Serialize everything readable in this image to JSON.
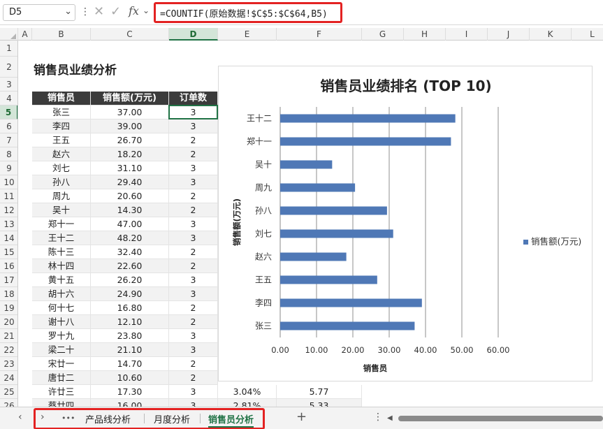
{
  "formula_bar": {
    "name_box": "D5",
    "fx_label": "fx",
    "formula": "=COUNTIF(原始数据!$C$5:$C$64,B5)"
  },
  "columns": [
    "A",
    "B",
    "C",
    "D",
    "E",
    "F",
    "G",
    "H",
    "I",
    "J",
    "K",
    "L"
  ],
  "rows": [
    "1",
    "2",
    "3",
    "4",
    "5",
    "6",
    "7",
    "8",
    "9",
    "10",
    "11",
    "12",
    "13",
    "14",
    "15",
    "16",
    "17",
    "18",
    "19",
    "20",
    "21",
    "22",
    "23",
    "24",
    "25",
    "26"
  ],
  "sheet_title": "销售员业绩分析",
  "table": {
    "headers": [
      "销售员",
      "销售额(万元)",
      "订单数"
    ],
    "rows": [
      [
        "张三",
        "37.00",
        "3"
      ],
      [
        "李四",
        "39.00",
        "3"
      ],
      [
        "王五",
        "26.70",
        "2"
      ],
      [
        "赵六",
        "18.20",
        "2"
      ],
      [
        "刘七",
        "31.10",
        "3"
      ],
      [
        "孙八",
        "29.40",
        "3"
      ],
      [
        "周九",
        "20.60",
        "2"
      ],
      [
        "吴十",
        "14.30",
        "2"
      ],
      [
        "郑十一",
        "47.00",
        "3"
      ],
      [
        "王十二",
        "48.20",
        "3"
      ],
      [
        "陈十三",
        "32.40",
        "2"
      ],
      [
        "林十四",
        "22.60",
        "2"
      ],
      [
        "黄十五",
        "26.20",
        "3"
      ],
      [
        "胡十六",
        "24.90",
        "3"
      ],
      [
        "何十七",
        "16.80",
        "2"
      ],
      [
        "谢十八",
        "12.10",
        "2"
      ],
      [
        "罗十九",
        "23.80",
        "3"
      ],
      [
        "梁二十",
        "21.10",
        "3"
      ],
      [
        "宋廿一",
        "14.70",
        "2"
      ],
      [
        "唐廿二",
        "10.60",
        "2"
      ],
      [
        "许廿三",
        "17.30",
        "3",
        "3.04%",
        "5.77"
      ],
      [
        "蔡廿四",
        "16.00",
        "3",
        "2.81%",
        "5.33"
      ]
    ]
  },
  "chart_data": {
    "type": "bar",
    "orientation": "horizontal",
    "title": "销售员业绩排名 (TOP 10)",
    "categories": [
      "张三",
      "李四",
      "王五",
      "赵六",
      "刘七",
      "孙八",
      "周九",
      "吴十",
      "郑十一",
      "王十二"
    ],
    "series": [
      {
        "name": "销售额(万元)",
        "values": [
          37.0,
          39.0,
          26.7,
          18.2,
          31.1,
          29.4,
          20.6,
          14.3,
          47.0,
          48.2
        ],
        "color": "#4f78b6"
      }
    ],
    "xlabel": "销售员",
    "ylabel": "销售额(万元)",
    "xlim": [
      0,
      60
    ],
    "x_ticks": [
      "0.00",
      "10.00",
      "20.00",
      "30.00",
      "40.00",
      "50.00",
      "60.00"
    ],
    "grid": true,
    "legend_position": "right"
  },
  "tabs": {
    "prev_icon": "‹",
    "next_icon": "›",
    "more": "•••",
    "items": [
      "产品线分析",
      "月度分析",
      "销售员分析"
    ],
    "active": "销售员分析",
    "add_icon": "+",
    "options_icon": "⋮",
    "scroll_left_icon": "◀"
  },
  "colors": {
    "accent": "#217346",
    "highlight": "#e32222",
    "header_bg": "#3b3b3b",
    "bar": "#4f78b6"
  }
}
